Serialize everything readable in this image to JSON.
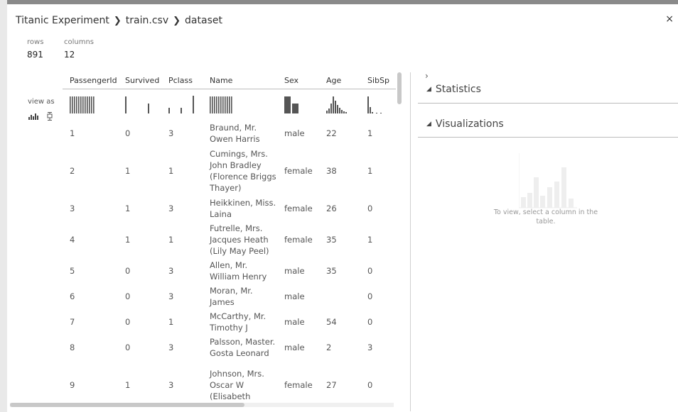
{
  "breadcrumb": {
    "part1": "Titanic Experiment",
    "part2": "train.csv",
    "part3": "dataset",
    "separator": "❯"
  },
  "close_label": "×",
  "meta": {
    "rows_label": "rows",
    "rows_value": "891",
    "columns_label": "columns",
    "columns_value": "12"
  },
  "view_as_label": "view as",
  "table": {
    "headers": [
      "PassengerId",
      "Survived",
      "Pclass",
      "Name",
      "Sex",
      "Age",
      "SibSp"
    ],
    "rows": [
      [
        "1",
        "0",
        "3",
        "Braund, Mr. Owen Harris",
        "male",
        "22",
        "1"
      ],
      [
        "2",
        "1",
        "1",
        "Cumings, Mrs. John Bradley (Florence Briggs Thayer)",
        "female",
        "38",
        "1"
      ],
      [
        "3",
        "1",
        "3",
        "Heikkinen, Miss. Laina",
        "female",
        "26",
        "0"
      ],
      [
        "4",
        "1",
        "1",
        "Futrelle, Mrs. Jacques Heath (Lily May Peel)",
        "female",
        "35",
        "1"
      ],
      [
        "5",
        "0",
        "3",
        "Allen, Mr. William Henry",
        "male",
        "35",
        "0"
      ],
      [
        "6",
        "0",
        "3",
        "Moran, Mr. James",
        "male",
        "",
        "0"
      ],
      [
        "7",
        "0",
        "1",
        "McCarthy, Mr. Timothy J",
        "male",
        "54",
        "0"
      ],
      [
        "8",
        "0",
        "3",
        "Palsson, Master. Gosta Leonard",
        "male",
        "2",
        "3"
      ],
      [
        "9",
        "1",
        "3",
        "Johnson, Mrs. Oscar W (Elisabeth",
        "female",
        "27",
        "0"
      ]
    ]
  },
  "right_panel": {
    "chevron": "›",
    "statistics_label": "Statistics",
    "visualizations_label": "Visualizations",
    "empty_message": "To view, select a column in the table."
  },
  "icons": {
    "histogram": "histogram-icon",
    "boxplot": "boxplot-icon",
    "collapse": "triangle-down-icon"
  }
}
